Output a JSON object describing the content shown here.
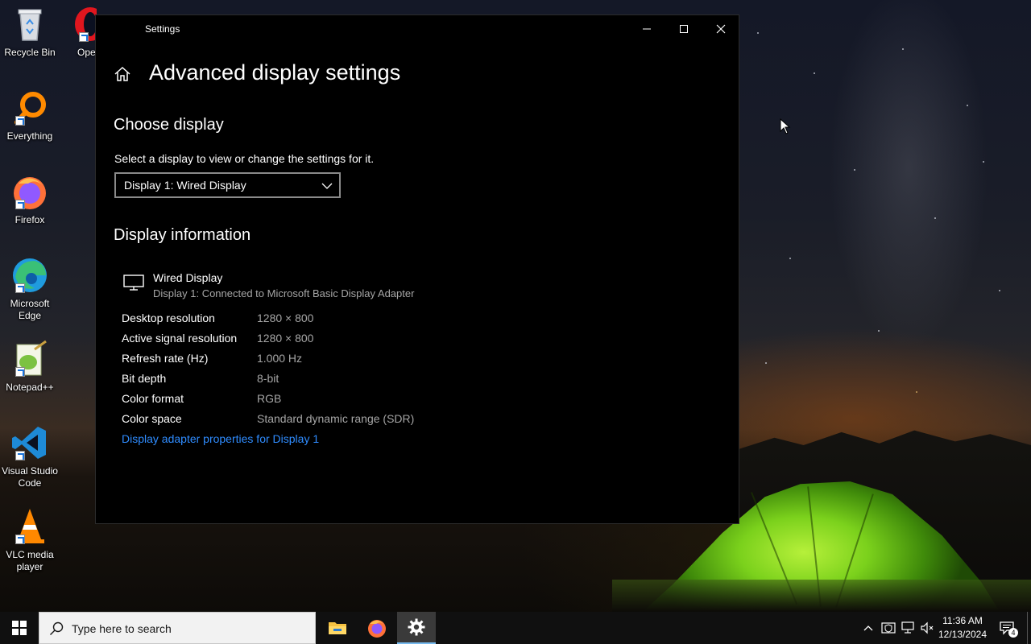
{
  "desktop": {
    "icons": [
      {
        "label": "Recycle Bin",
        "icon": "recycle-bin-icon"
      },
      {
        "label": "Ope",
        "icon": "opera-icon"
      },
      {
        "label": "Everything",
        "icon": "everything-search-icon"
      },
      {
        "label": "Firefox",
        "icon": "firefox-icon"
      },
      {
        "label": "Microsoft Edge",
        "icon": "edge-icon"
      },
      {
        "label": "Notepad++",
        "icon": "notepadpp-icon"
      },
      {
        "label": "Visual Studio Code",
        "icon": "vscode-icon"
      },
      {
        "label": "VLC media player",
        "icon": "vlc-icon"
      }
    ]
  },
  "window": {
    "title": "Settings",
    "page_title": "Advanced display settings",
    "choose_display": {
      "heading": "Choose display",
      "description": "Select a display to view or change the settings for it.",
      "selected_display": "Display 1: Wired Display"
    },
    "display_info": {
      "heading": "Display information",
      "name": "Wired Display",
      "subtitle": "Display 1: Connected to Microsoft Basic Display Adapter",
      "rows": [
        {
          "key": "Desktop resolution",
          "value": "1280 × 800"
        },
        {
          "key": "Active signal resolution",
          "value": "1280 × 800"
        },
        {
          "key": "Refresh rate (Hz)",
          "value": "1.000 Hz"
        },
        {
          "key": "Bit depth",
          "value": "8-bit"
        },
        {
          "key": "Color format",
          "value": "RGB"
        },
        {
          "key": "Color space",
          "value": "Standard dynamic range (SDR)"
        }
      ],
      "link": "Display adapter properties for Display 1"
    }
  },
  "taskbar": {
    "search_placeholder": "Type here to search",
    "apps": [
      "file-explorer-icon",
      "firefox-icon",
      "settings-gear-icon"
    ],
    "clock_time": "11:36 AM",
    "clock_date": "12/13/2024",
    "notification_count": "4"
  },
  "colors": {
    "link": "#2f8cff",
    "window_bg": "#000000",
    "taskbar_bg": "#101010"
  }
}
